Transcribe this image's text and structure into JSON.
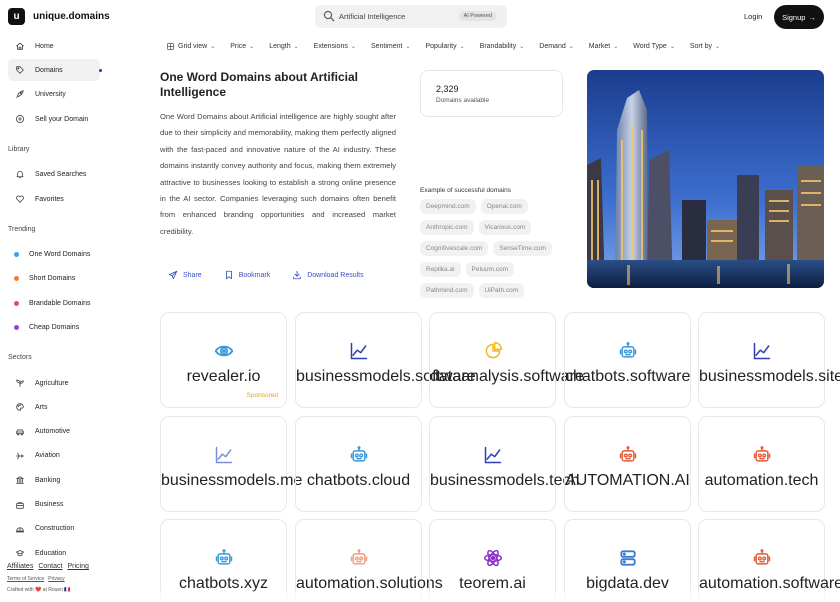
{
  "header": {
    "brand": "unique.domains",
    "logo_glyph": "u",
    "search_value": "Artificial Intelligence",
    "ai_badge": "AI Powered",
    "login": "Login",
    "signup": "Signup",
    "signup_arrow": "→"
  },
  "sidebar": {
    "nav": [
      {
        "label": "Home",
        "icon": "home-icon"
      },
      {
        "label": "Domains",
        "icon": "tag-icon"
      },
      {
        "label": "University",
        "icon": "rocket-icon"
      },
      {
        "label": "Sell your Domain",
        "icon": "plus-circle-icon"
      }
    ],
    "library_title": "Library",
    "library": [
      {
        "label": "Saved Searches",
        "icon": "bell-icon"
      },
      {
        "label": "Favorites",
        "icon": "heart-icon"
      }
    ],
    "trending_title": "Trending",
    "trending": [
      {
        "label": "One Word Domains",
        "color": "#3aa0e8"
      },
      {
        "label": "Short Domains",
        "color": "#ef7d35"
      },
      {
        "label": "Brandable Domains",
        "color": "#e8428c"
      },
      {
        "label": "Cheap Domains",
        "color": "#9b3fd6"
      }
    ],
    "sectors_title": "Sectors",
    "sectors": [
      {
        "label": "Agriculture",
        "icon": "sprout-icon"
      },
      {
        "label": "Arts",
        "icon": "palette-icon"
      },
      {
        "label": "Automotive",
        "icon": "car-icon"
      },
      {
        "label": "Aviation",
        "icon": "plane-icon"
      },
      {
        "label": "Banking",
        "icon": "bank-icon"
      },
      {
        "label": "Business",
        "icon": "briefcase-icon"
      },
      {
        "label": "Construction",
        "icon": "helmet-icon"
      },
      {
        "label": "Education",
        "icon": "graduation-icon"
      }
    ],
    "footer": {
      "links": [
        "Affiliates",
        "Contact",
        "Pricing"
      ],
      "small_links": [
        "Terms of Service",
        "Privacy"
      ],
      "credit": "Crafted with ❤️ at Rouen 🇫🇷"
    }
  },
  "filters": [
    "Grid view",
    "Price",
    "Length",
    "Extensions",
    "Sentiment",
    "Popularity",
    "Brandability",
    "Demand",
    "Market",
    "Word Type",
    "Sort by"
  ],
  "main": {
    "title": "One Word Domains about Artificial Intelligence",
    "description": "One Word Domains about Artificial intelligence are highly sought after due to their simplicity and memorability, making them perfectly aligned with the fast-paced and innovative nature of the AI industry. These domains instantly convey authority and focus, making them extremely attractive to businesses looking to establish a strong online presence in the AI sector. Companies leveraging such domains often benefit from enhanced branding opportunities and increased market credibility.",
    "actions": [
      {
        "label": "Share",
        "icon": "send-icon"
      },
      {
        "label": "Bookmark",
        "icon": "bookmark-icon"
      },
      {
        "label": "Download Results",
        "icon": "download-icon"
      }
    ],
    "stat_number": "2,329",
    "stat_label": "Domains available",
    "examples_title": "Example of successful domains",
    "examples": [
      "Deepmind.com",
      "Openai.com",
      "Anthropic.com",
      "Vicarious.com",
      "Cognitivescale.com",
      "SenseTime.com",
      "Replika.ai",
      "Petuum.com",
      "Pathmind.com",
      "UiPath.com"
    ]
  },
  "cards": [
    {
      "name": "revealer.io",
      "icon": "eye-icon",
      "color": "#3a9ad9",
      "sponsored": "Sponsored"
    },
    {
      "name": "businessmodels.software",
      "icon": "chart-line-icon",
      "color": "#2e3fae"
    },
    {
      "name": "dataanalysis.software",
      "icon": "pie-chart-icon",
      "color": "#f2b81d"
    },
    {
      "name": "chatbots.software",
      "icon": "robot-icon",
      "color": "#3a9ad9"
    },
    {
      "name": "businessmodels.site",
      "icon": "chart-line-icon",
      "color": "#2e3fae"
    },
    {
      "name": "businessmodels.me",
      "icon": "chart-line-icon",
      "color": "#7c8ed8"
    },
    {
      "name": "chatbots.cloud",
      "icon": "robot-icon",
      "color": "#3a9ad9"
    },
    {
      "name": "businessmodels.tech",
      "icon": "chart-line-icon",
      "color": "#2e3fae"
    },
    {
      "name": "AUTOMATION.AI",
      "icon": "robot-icon",
      "color": "#e85a3a"
    },
    {
      "name": "automation.tech",
      "icon": "robot-icon",
      "color": "#e85a3a"
    },
    {
      "name": "chatbots.xyz",
      "icon": "robot-icon",
      "color": "#3a9ad9"
    },
    {
      "name": "automation.solutions",
      "icon": "robot-icon",
      "color": "#f0a080"
    },
    {
      "name": "teorem.ai",
      "icon": "atom-icon",
      "color": "#8b2fc9"
    },
    {
      "name": "bigdata.dev",
      "icon": "server-icon",
      "color": "#3a7bd5"
    },
    {
      "name": "automation.software",
      "icon": "robot-icon",
      "color": "#e85a3a"
    }
  ]
}
